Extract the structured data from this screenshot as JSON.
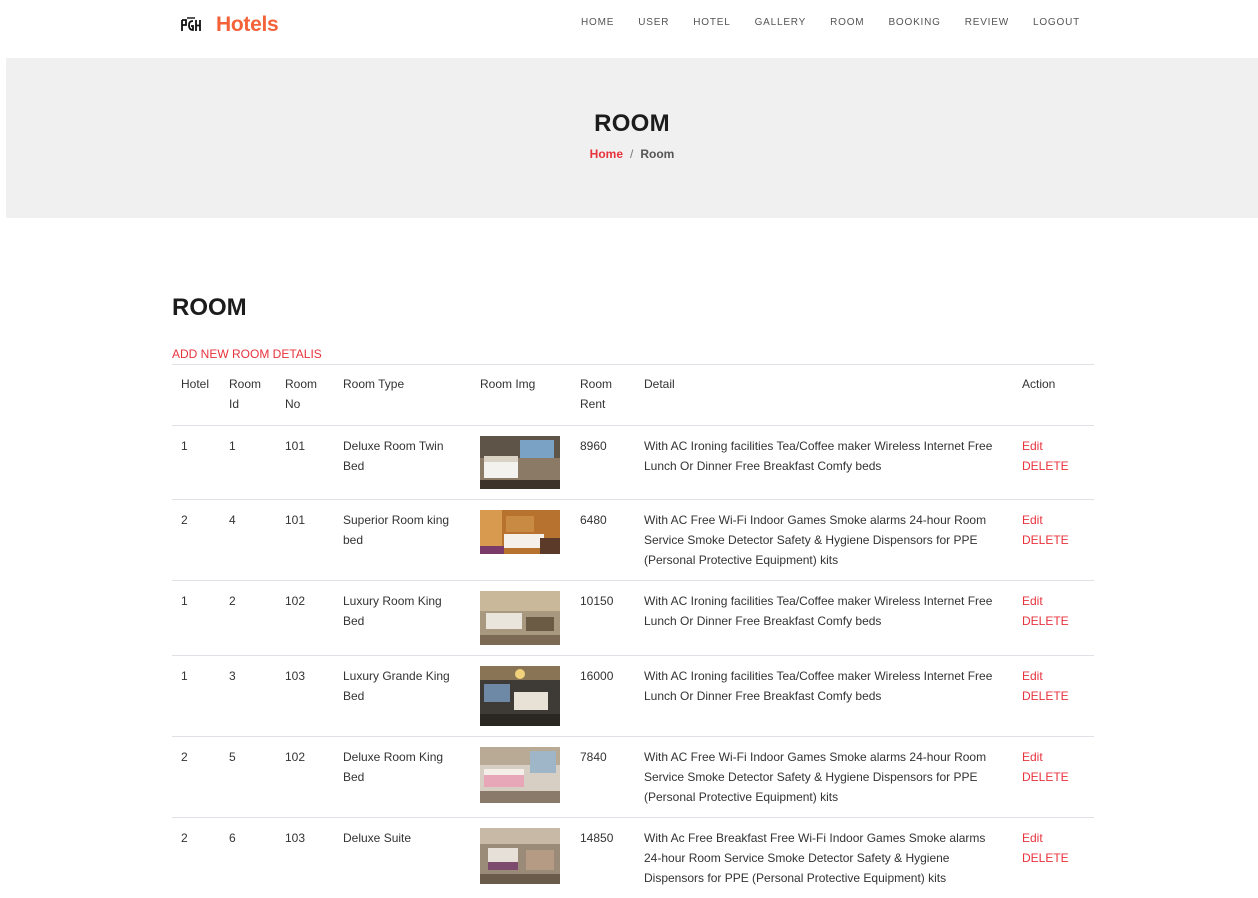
{
  "header": {
    "logo_text": "PGH",
    "brand": "Hotels",
    "nav": [
      "HOME",
      "USER",
      "HOTEL",
      "GALLERY",
      "ROOM",
      "BOOKING",
      "REVIEW",
      "LOGOUT"
    ]
  },
  "hero": {
    "title": "ROOM",
    "breadcrumb": {
      "home": "Home",
      "separator": "/",
      "current": "Room"
    }
  },
  "main": {
    "title": "ROOM",
    "add_link": "ADD NEW ROOM DETALIS",
    "table": {
      "columns": [
        "Hotel",
        "Room Id",
        "Room No",
        "Room Type",
        "Room Img",
        "Room Rent",
        "Detail",
        "Action"
      ],
      "rows": [
        {
          "hotel": "1",
          "room_id": "1",
          "room_no": "101",
          "room_type": "Deluxe Room Twin Bed",
          "rent": "8960",
          "detail": "With AC Ironing facilities Tea/Coffee maker Wireless Internet Free Lunch Or Dinner Free Breakfast Comfy beds",
          "edit": "Edit",
          "delete": "DELETE"
        },
        {
          "hotel": "2",
          "room_id": "4",
          "room_no": "101",
          "room_type": "Superior Room king bed",
          "rent": "6480",
          "detail": "With AC Free Wi-Fi Indoor Games Smoke alarms 24-hour Room Service Smoke Detector Safety & Hygiene Dispensors for PPE (Personal Protective Equipment) kits",
          "edit": "Edit",
          "delete": "DELETE"
        },
        {
          "hotel": "1",
          "room_id": "2",
          "room_no": "102",
          "room_type": "Luxury Room King Bed",
          "rent": "10150",
          "detail": "With AC Ironing facilities Tea/Coffee maker Wireless Internet Free Lunch Or Dinner Free Breakfast Comfy beds",
          "edit": "Edit",
          "delete": "DELETE"
        },
        {
          "hotel": "1",
          "room_id": "3",
          "room_no": "103",
          "room_type": "Luxury Grande King Bed",
          "rent": "16000",
          "detail": "With AC Ironing facilities Tea/Coffee maker Wireless Internet Free Lunch Or Dinner Free Breakfast Comfy beds",
          "edit": "Edit",
          "delete": "DELETE"
        },
        {
          "hotel": "2",
          "room_id": "5",
          "room_no": "102",
          "room_type": "Deluxe Room King Bed",
          "rent": "7840",
          "detail": "With AC Free Wi-Fi Indoor Games Smoke alarms 24-hour Room Service Smoke Detector Safety & Hygiene Dispensors for PPE (Personal Protective Equipment) kits",
          "edit": "Edit",
          "delete": "DELETE"
        },
        {
          "hotel": "2",
          "room_id": "6",
          "room_no": "103",
          "room_type": "Deluxe Suite",
          "rent": "14850",
          "detail": "With Ac Free Breakfast Free Wi-Fi Indoor Games Smoke alarms 24-hour Room Service Smoke Detector Safety & Hygiene Dispensors for PPE (Personal Protective Equipment) kits",
          "edit": "Edit",
          "delete": "DELETE"
        }
      ]
    }
  },
  "colors": {
    "brand": "#f4623a",
    "accent": "#e8323c",
    "hero_bg": "#f0f0f0"
  }
}
